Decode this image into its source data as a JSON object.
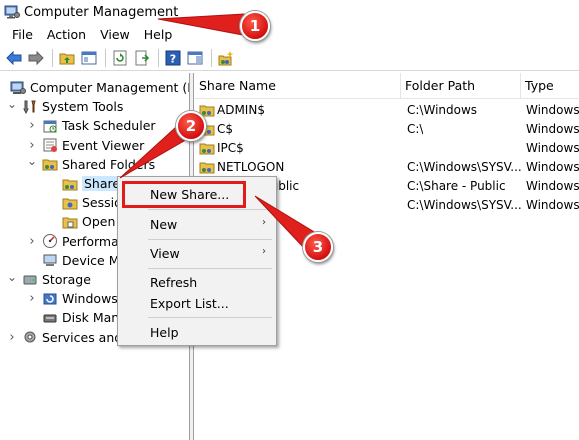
{
  "window": {
    "title": "Computer Management"
  },
  "menu": [
    "File",
    "Action",
    "View",
    "Help"
  ],
  "toolbar": [
    "back-icon",
    "forward-icon",
    "up-folder-icon",
    "show-hide-tree-icon",
    "refresh-icon",
    "export-list-icon",
    "help-icon",
    "action-pane-icon",
    "new-share-icon"
  ],
  "tree": [
    {
      "label": "Computer Management (Local",
      "icon": "computer-management-icon",
      "expander": "none",
      "level": 0
    },
    {
      "label": "System Tools",
      "icon": "system-tools-icon",
      "expander": "open",
      "level": 1
    },
    {
      "label": "Task Scheduler",
      "icon": "task-scheduler-icon",
      "expander": "closed",
      "level": 2
    },
    {
      "label": "Event Viewer",
      "icon": "event-viewer-icon",
      "expander": "closed",
      "level": 2
    },
    {
      "label": "Shared Folders",
      "icon": "shared-folders-icon",
      "expander": "open",
      "level": 2
    },
    {
      "label": "Shares",
      "icon": "shares-icon",
      "expander": "none",
      "level": 3,
      "selected": true
    },
    {
      "label": "Sessions",
      "icon": "sessions-icon",
      "expander": "none",
      "level": 3
    },
    {
      "label": "Open Files",
      "icon": "open-files-icon",
      "expander": "none",
      "level": 3
    },
    {
      "label": "Performance",
      "icon": "performance-icon",
      "expander": "closed",
      "level": 2
    },
    {
      "label": "Device Manager",
      "icon": "device-manager-icon",
      "expander": "none",
      "level": 2
    },
    {
      "label": "Storage",
      "icon": "storage-icon",
      "expander": "open",
      "level": 1
    },
    {
      "label": "Windows Server Backup",
      "icon": "windows-backup-icon",
      "expander": "closed",
      "level": 2
    },
    {
      "label": "Disk Management",
      "icon": "disk-management-icon",
      "expander": "none",
      "level": 2
    },
    {
      "label": "Services and Applications",
      "icon": "services-icon",
      "expander": "closed",
      "level": 1
    }
  ],
  "list": {
    "columns": [
      "Share Name",
      "Folder Path",
      "Type"
    ],
    "rows": [
      {
        "name": "ADMIN$",
        "path": "C:\\Windows",
        "type": "Windows"
      },
      {
        "name": "C$",
        "path": "C:\\",
        "type": "Windows"
      },
      {
        "name": "IPC$",
        "path": "",
        "type": "Windows"
      },
      {
        "name": "NETLOGON",
        "path": "C:\\Windows\\SYSV...",
        "type": "Windows"
      },
      {
        "name": "Share - Public",
        "path": "C:\\Share - Public",
        "type": "Windows"
      },
      {
        "name": "SYSVOL",
        "path": "C:\\Windows\\SYSV...",
        "type": "Windows"
      }
    ]
  },
  "context_menu": {
    "new_share": "New Share...",
    "new": "New",
    "view": "View",
    "refresh": "Refresh",
    "export_list": "Export List...",
    "help": "Help",
    "submenu_arrow": "›"
  },
  "callouts": [
    "1",
    "2",
    "3"
  ],
  "colors": {
    "selection": "#cce8ff",
    "annotation_red": "#e21b1b",
    "menu_bg": "#f2f2f2"
  }
}
